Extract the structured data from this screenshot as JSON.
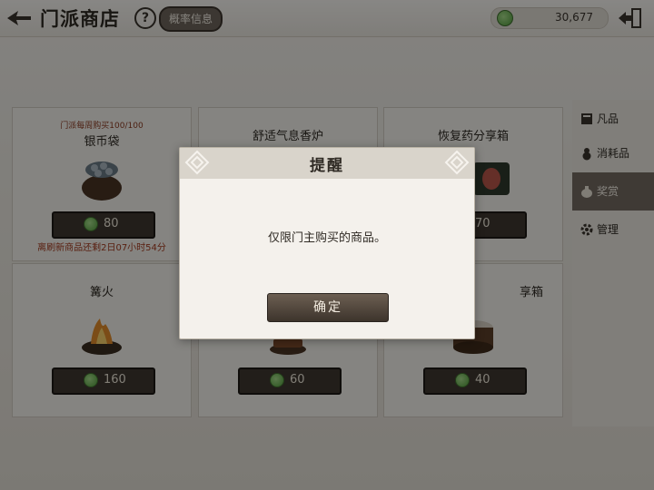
{
  "header": {
    "title": "门派商店",
    "help_label": "?",
    "prob_label": "概率信息",
    "currency_value": "30,677",
    "currency_icon": "jade-coin-icon"
  },
  "side_tabs": [
    {
      "label": "凡品",
      "icon": "book-icon",
      "active": false
    },
    {
      "label": "消耗品",
      "icon": "gourd-icon",
      "active": false
    },
    {
      "label": "奖赏",
      "icon": "money-bag-icon",
      "active": true
    },
    {
      "label": "管理",
      "icon": "gear-icon",
      "active": false
    }
  ],
  "items": [
    {
      "subtitle": "门派每周购买100/100",
      "name": "银币袋",
      "price": "80",
      "timer": "离刷新商品还剩2日07小时54分",
      "icon": "coin-bag-icon"
    },
    {
      "name": "舒适气息香炉",
      "price": "",
      "icon": "incense-burner-icon"
    },
    {
      "name": "恢复药分享箱",
      "price": "70",
      "icon": "medicine-box-icon"
    },
    {
      "name": "篝火",
      "price": "160",
      "icon": "bonfire-icon"
    },
    {
      "name": "",
      "price": "60",
      "icon": "brazier-icon"
    },
    {
      "name": "享箱",
      "price": "40",
      "icon": "steamer-box-icon"
    }
  ],
  "dialog": {
    "title": "提醒",
    "message": "仅限门主购买的商品。",
    "confirm_label": "确定"
  },
  "colors": {
    "accent": "#736b62",
    "price_bg": "#3e3731",
    "timer_red": "#a23a1e",
    "coin_green": "#4f9a3b"
  }
}
